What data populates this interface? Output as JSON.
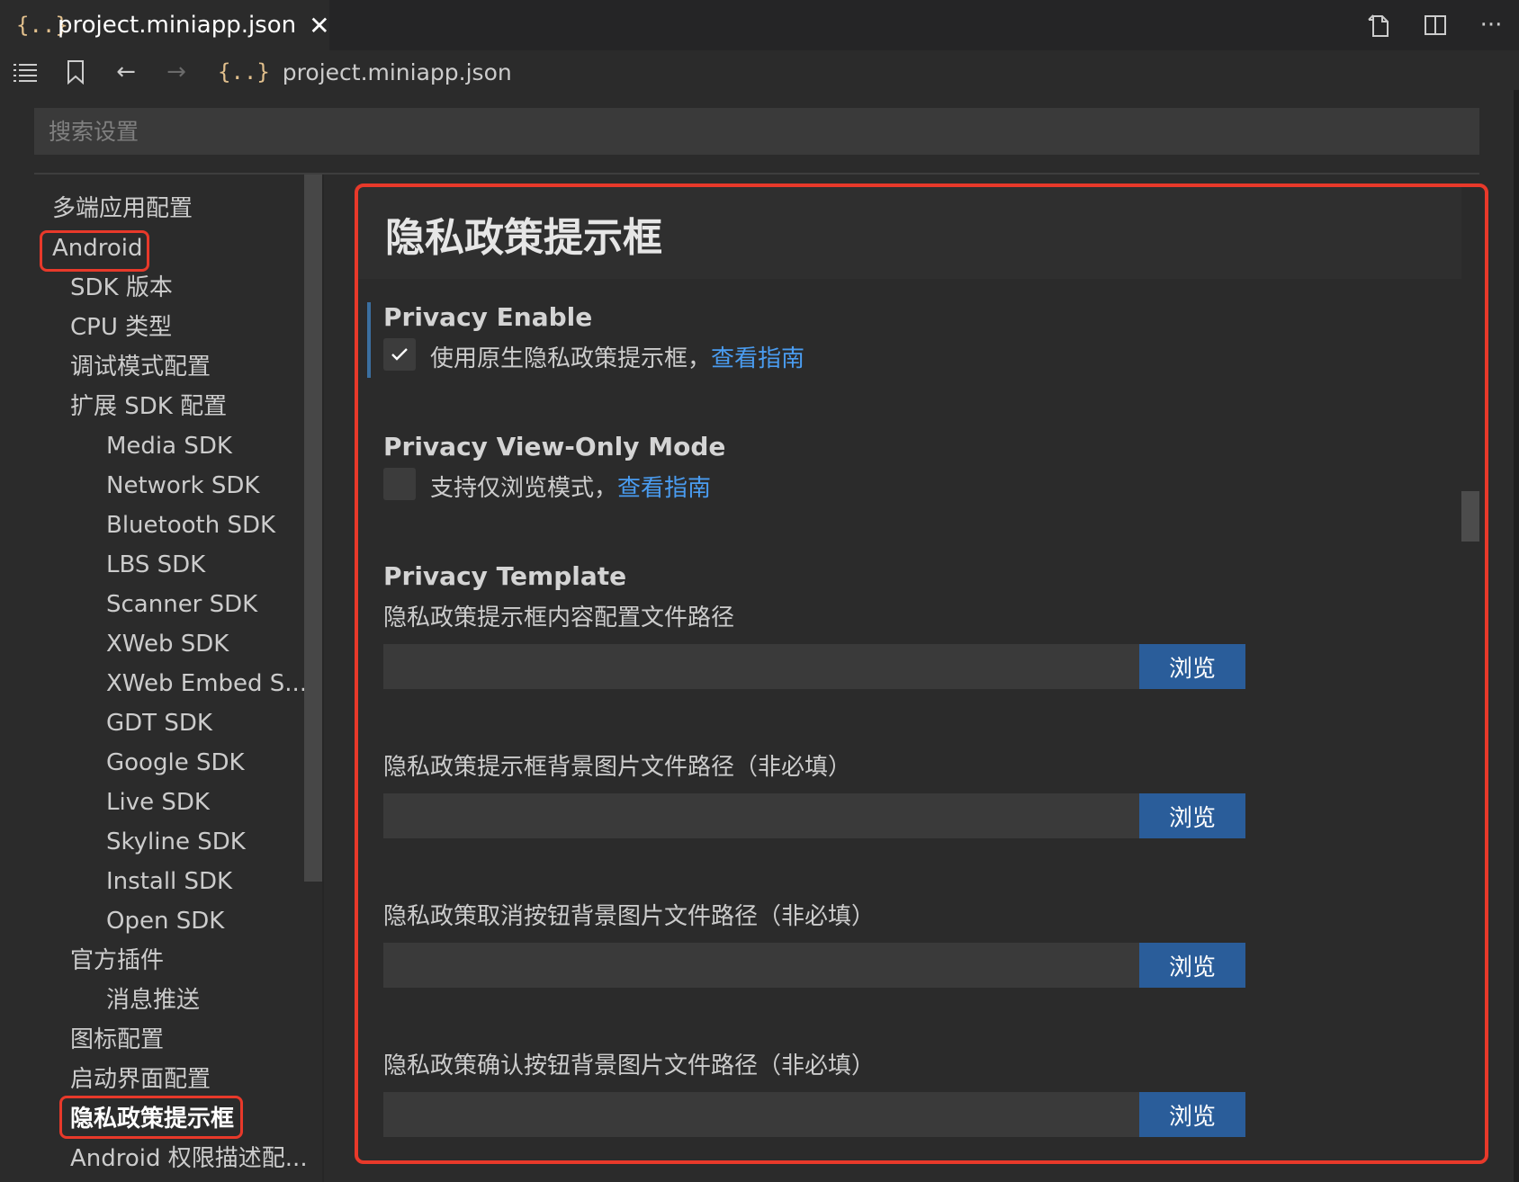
{
  "tab": {
    "icon": "json-icon",
    "title": "project.miniapp.json"
  },
  "tab_actions": [
    "open-file-icon",
    "split-editor-icon",
    "more-icon"
  ],
  "toolbar": {
    "crumb_icon": "{..}",
    "breadcrumb": "project.miniapp.json"
  },
  "search": {
    "placeholder": "搜索设置",
    "value": ""
  },
  "sidebar": {
    "items": [
      "多端应用配置",
      "Android",
      "SDK 版本",
      "CPU 类型",
      "调试模式配置",
      "扩展 SDK 配置",
      "Media SDK",
      "Network SDK",
      "Bluetooth SDK",
      "LBS SDK",
      "Scanner SDK",
      "XWeb SDK",
      "XWeb Embed S...",
      "GDT SDK",
      "Google SDK",
      "Live SDK",
      "Skyline SDK",
      "Install SDK",
      "Open SDK",
      "官方插件",
      "消息推送",
      "图标配置",
      "启动界面配置",
      "隐私政策提示框",
      "Android 权限描述配..."
    ],
    "active": "隐私政策提示框"
  },
  "main": {
    "title": "隐私政策提示框",
    "privacy_enable": {
      "label": "Privacy Enable",
      "checked": true,
      "text": "使用原生隐私政策提示框，",
      "link": "查看指南"
    },
    "privacy_view_only": {
      "label": "Privacy View-Only Mode",
      "checked": false,
      "text": "支持仅浏览模式，",
      "link": "查看指南"
    },
    "privacy_template": {
      "label": "Privacy Template",
      "fields": [
        {
          "desc": "隐私政策提示框内容配置文件路径",
          "value": "",
          "button": "浏览"
        },
        {
          "desc": "隐私政策提示框背景图片文件路径（非必填）",
          "value": "",
          "button": "浏览"
        },
        {
          "desc": "隐私政策取消按钮背景图片文件路径（非必填）",
          "value": "",
          "button": "浏览"
        },
        {
          "desc": "隐私政策确认按钮背景图片文件路径（非必填）",
          "value": "",
          "button": "浏览"
        }
      ]
    }
  },
  "colors": {
    "highlight": "#e8392a",
    "link": "#4a9cf0",
    "button": "#2a5d9a"
  }
}
